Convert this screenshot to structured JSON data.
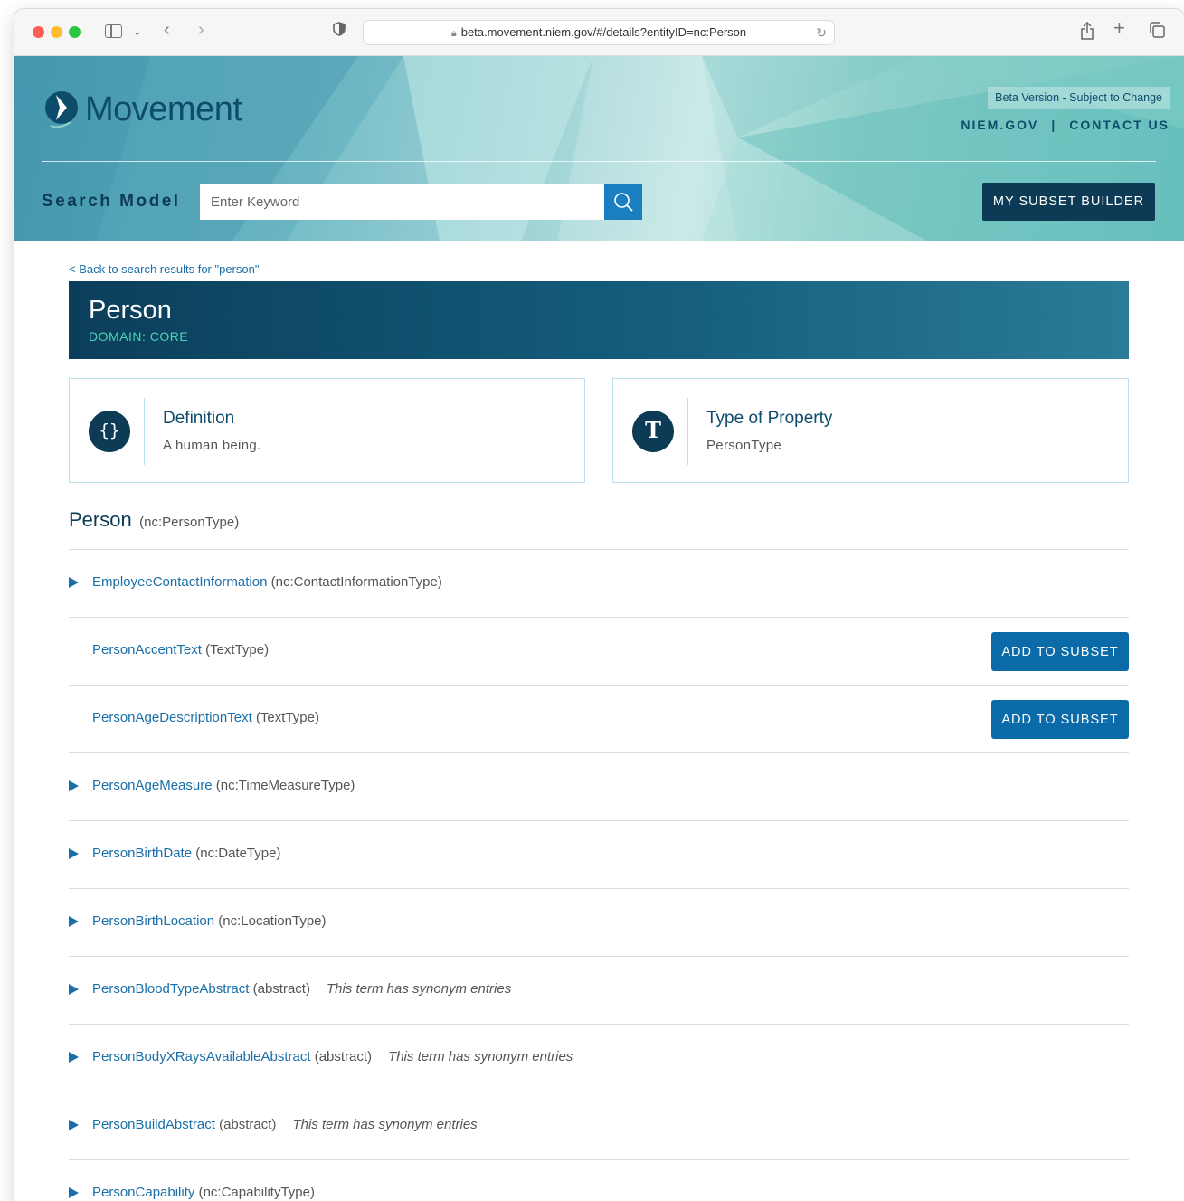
{
  "browser": {
    "url": "beta.movement.niem.gov/#/details?entityID=nc:Person"
  },
  "header": {
    "logo_text": "Movement",
    "beta_badge": "Beta Version - Subject to Change",
    "links": [
      "NIEM.GOV",
      "CONTACT US"
    ],
    "link_separator": "|",
    "search_label": "Search Model",
    "search_placeholder": "Enter Keyword",
    "subset_builder_label": "MY SUBSET BUILDER"
  },
  "back_link": "< Back to search results for \"person\"",
  "entity": {
    "name": "Person",
    "domain": "DOMAIN: CORE"
  },
  "cards": {
    "definition": {
      "icon": "{}",
      "label": "Definition",
      "value": "A human being."
    },
    "type": {
      "icon": "T",
      "label": "Type of Property",
      "value": "PersonType"
    }
  },
  "section": {
    "name": "Person",
    "type": "(nc:PersonType)"
  },
  "add_to_subset_label": "ADD TO SUBSET",
  "properties": [
    {
      "name": "EmployeeContactInformation",
      "type": "(nc:ContactInformationType)",
      "expandable": true,
      "synonym": "",
      "add": false
    },
    {
      "name": "PersonAccentText",
      "type": "(TextType)",
      "expandable": false,
      "synonym": "",
      "add": true
    },
    {
      "name": "PersonAgeDescriptionText",
      "type": "(TextType)",
      "expandable": false,
      "synonym": "",
      "add": true
    },
    {
      "name": "PersonAgeMeasure",
      "type": "(nc:TimeMeasureType)",
      "expandable": true,
      "synonym": "",
      "add": false
    },
    {
      "name": "PersonBirthDate",
      "type": "(nc:DateType)",
      "expandable": true,
      "synonym": "",
      "add": false
    },
    {
      "name": "PersonBirthLocation",
      "type": "(nc:LocationType)",
      "expandable": true,
      "synonym": "",
      "add": false
    },
    {
      "name": "PersonBloodTypeAbstract",
      "type": "(abstract)",
      "expandable": true,
      "synonym": "This term has synonym entries",
      "add": false
    },
    {
      "name": "PersonBodyXRaysAvailableAbstract",
      "type": "(abstract)",
      "expandable": true,
      "synonym": "This term has synonym entries",
      "add": false
    },
    {
      "name": "PersonBuildAbstract",
      "type": "(abstract)",
      "expandable": true,
      "synonym": "This term has synonym entries",
      "add": false
    },
    {
      "name": "PersonCapability",
      "type": "(nc:CapabilityType)",
      "expandable": true,
      "synonym": "",
      "add": false
    }
  ],
  "colors": {
    "brand_dark": "#0d3b55",
    "link_blue": "#1a6fa8",
    "domain_green": "#4cd3b8",
    "button_blue": "#0b6aa8"
  }
}
